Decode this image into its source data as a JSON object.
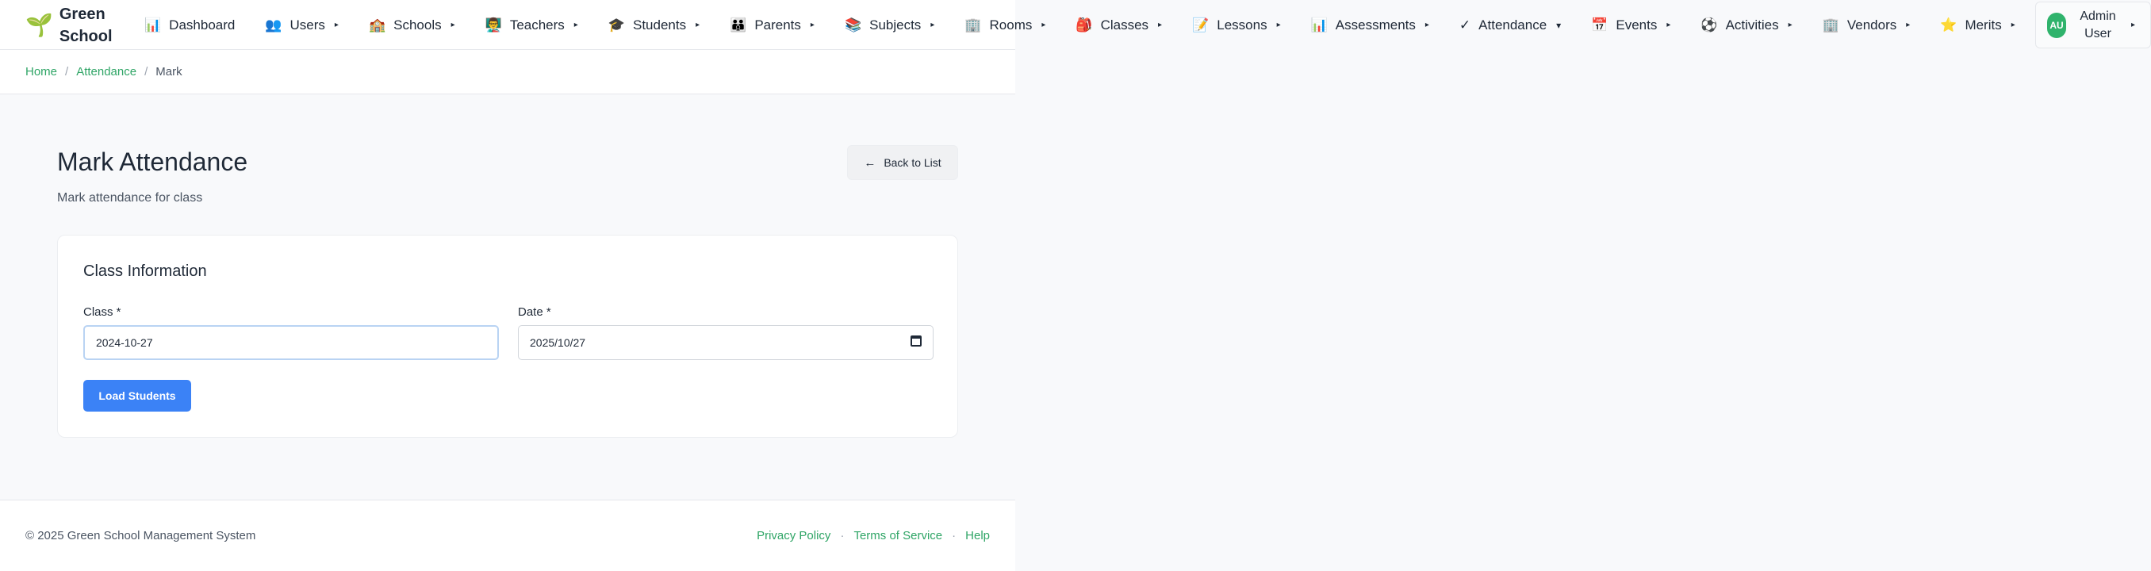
{
  "brand": {
    "logo": "🌱",
    "name": "Green School"
  },
  "nav": {
    "items": [
      {
        "icon": "📊",
        "label": "Dashboard",
        "caret": ""
      },
      {
        "icon": "👥",
        "label": "Users",
        "caret": "▸"
      },
      {
        "icon": "🏫",
        "label": "Schools",
        "caret": "▸"
      },
      {
        "icon": "👨‍🏫",
        "label": "Teachers",
        "caret": "▸"
      },
      {
        "icon": "🎓",
        "label": "Students",
        "caret": "▸"
      },
      {
        "icon": "👪",
        "label": "Parents",
        "caret": "▸"
      },
      {
        "icon": "📚",
        "label": "Subjects",
        "caret": "▸"
      },
      {
        "icon": "🏢",
        "label": "Rooms",
        "caret": "▸"
      },
      {
        "icon": "🎒",
        "label": "Classes",
        "caret": "▸"
      },
      {
        "icon": "📝",
        "label": "Lessons",
        "caret": "▸"
      },
      {
        "icon": "📊",
        "label": "Assessments",
        "caret": "▸"
      },
      {
        "icon": "✓",
        "label": "Attendance",
        "caret": "▾"
      },
      {
        "icon": "📅",
        "label": "Events",
        "caret": "▸"
      },
      {
        "icon": "⚽",
        "label": "Activities",
        "caret": "▸"
      },
      {
        "icon": "🏢",
        "label": "Vendors",
        "caret": "▸"
      },
      {
        "icon": "⭐",
        "label": "Merits",
        "caret": "▸"
      }
    ],
    "user": {
      "initials": "AU",
      "name": "Admin User",
      "caret": "▸"
    }
  },
  "breadcrumb": {
    "home": "Home",
    "section": "Attendance",
    "current": "Mark",
    "separator": "/"
  },
  "page": {
    "title": "Mark Attendance",
    "subtitle": "Mark attendance for class",
    "back_label": "Back to List",
    "back_icon": "←"
  },
  "card": {
    "title": "Class Information",
    "class_label": "Class *",
    "class_value": "2024-10-27",
    "date_label": "Date *",
    "date_value": "2025/10/27",
    "load_label": "Load Students"
  },
  "footer": {
    "copyright": "© 2025 Green School Management System",
    "links": [
      "Privacy Policy",
      "Terms of Service",
      "Help"
    ],
    "separator": "·"
  },
  "colors": {
    "accent_green": "#2fa566",
    "primary_blue": "#3b82f6",
    "avatar_green": "#2fb36c"
  }
}
